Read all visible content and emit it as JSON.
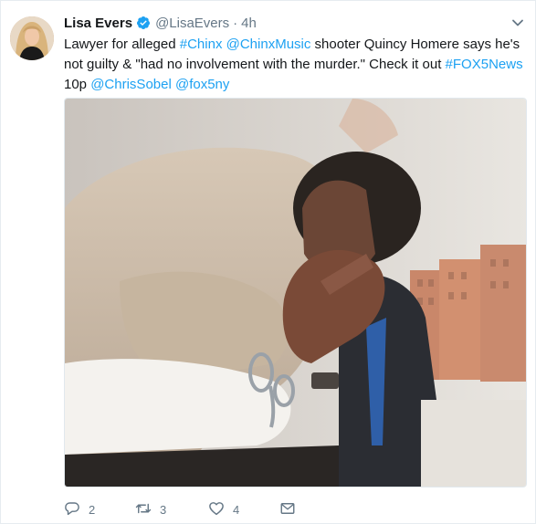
{
  "tweet": {
    "author_name": "Lisa Evers",
    "author_handle": "@LisaEvers",
    "separator": "·",
    "timestamp": "4h",
    "text_segments": [
      {
        "text": "Lawyer for alleged ",
        "link": false
      },
      {
        "text": "#Chinx",
        "link": true
      },
      {
        "text": " ",
        "link": false
      },
      {
        "text": "@ChinxMusic",
        "link": true
      },
      {
        "text": " shooter Quincy Homere says he's not guilty & \"had no involvement with the murder.\" Check it out ",
        "link": false
      },
      {
        "text": "#FOX5News",
        "link": true
      },
      {
        "text": " 10p ",
        "link": false
      },
      {
        "text": "@ChrisSobel",
        "link": true
      },
      {
        "text": " ",
        "link": false
      },
      {
        "text": "@fox5ny",
        "link": true
      }
    ],
    "reply_count": "2",
    "retweet_count": "3",
    "like_count": "4"
  },
  "icons": {
    "verified": "verified-badge-icon",
    "caret": "chevron-down-icon",
    "reply": "reply-icon",
    "retweet": "retweet-icon",
    "like": "heart-icon",
    "dm": "envelope-icon"
  },
  "colors": {
    "link": "#1da1f2",
    "muted": "#657786",
    "text": "#14171a",
    "verified": "#1da1f2"
  }
}
